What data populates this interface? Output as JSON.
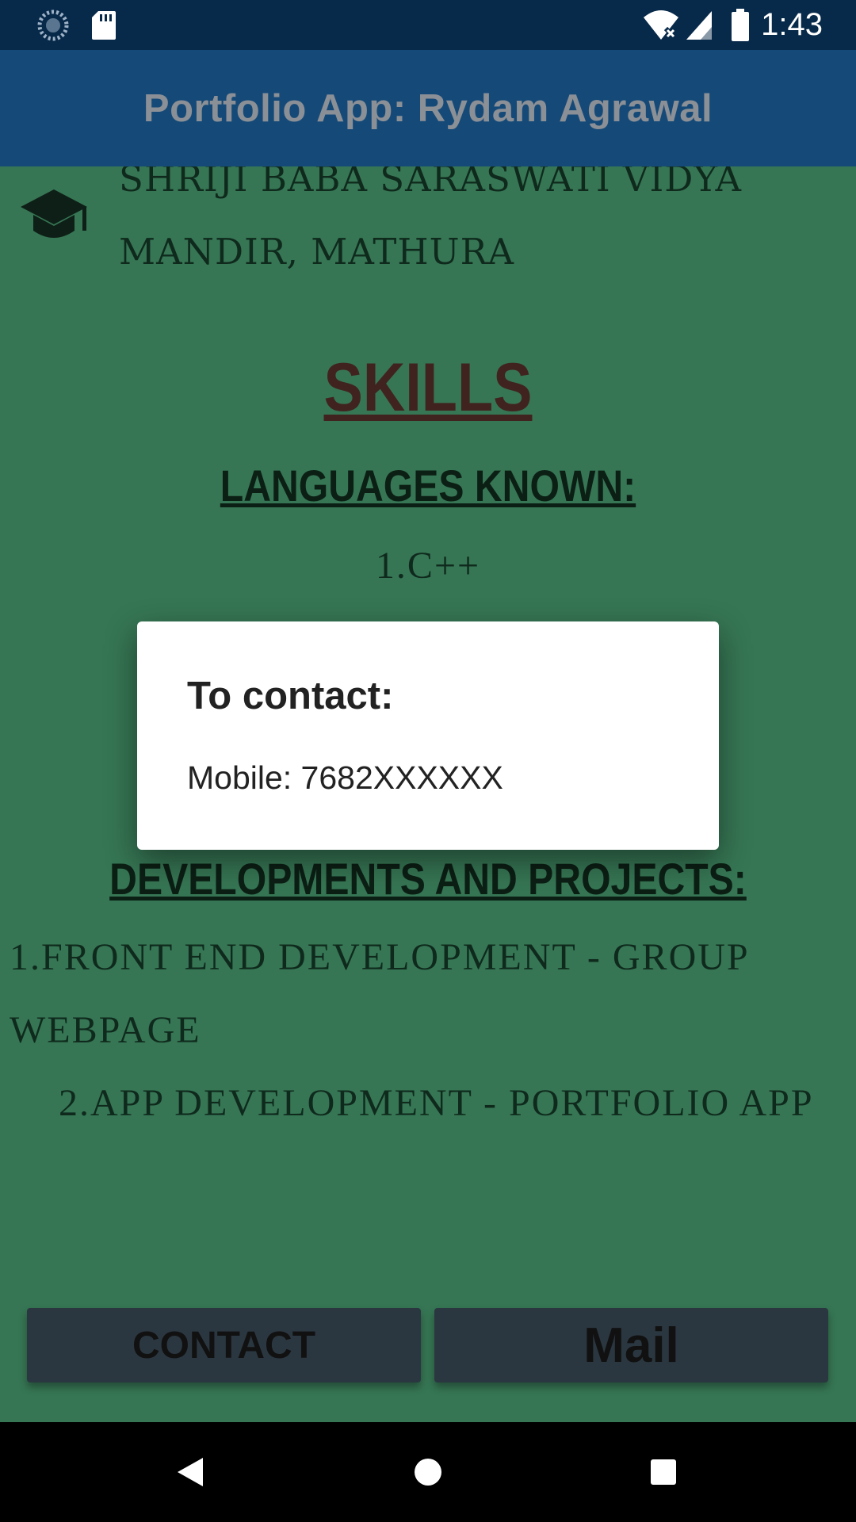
{
  "status_bar": {
    "time": "1:43",
    "icons": [
      "sync-icon",
      "sd-card-icon",
      "wifi-off-icon",
      "signal-icon",
      "battery-icon"
    ]
  },
  "app_bar": {
    "title": "Portfolio App: Rydam Agrawal"
  },
  "content": {
    "school_icon": "school-icon",
    "school_line1": "SHRIJI BABA SARASWATI VIDYA",
    "school_line2": "MANDIR, MATHURA",
    "skills_heading": "SKILLS",
    "languages_heading": "LANGUAGES KNOWN:",
    "language_1": "1.C++",
    "developments_heading": "DEVELOPMENTS AND PROJECTS:",
    "project_1_line1": "1.FRONT END DEVELOPMENT - GROUP",
    "project_1_line2": "WEBPAGE",
    "project_2": "2.APP DEVELOPMENT - PORTFOLIO APP"
  },
  "buttons": {
    "contact_label": "CONTACT",
    "mail_label": "Mail"
  },
  "dialog": {
    "title": "To contact:",
    "message": "Mobile: 7682XXXXXX"
  },
  "nav_bar": {
    "icons": [
      "back-icon",
      "home-icon",
      "recents-icon"
    ]
  },
  "colors": {
    "status_bar": "#082a4a",
    "app_bar": "#154a78",
    "content_background": "#367654",
    "button_background": "#2b3740",
    "dialog_background": "#ffffff"
  }
}
